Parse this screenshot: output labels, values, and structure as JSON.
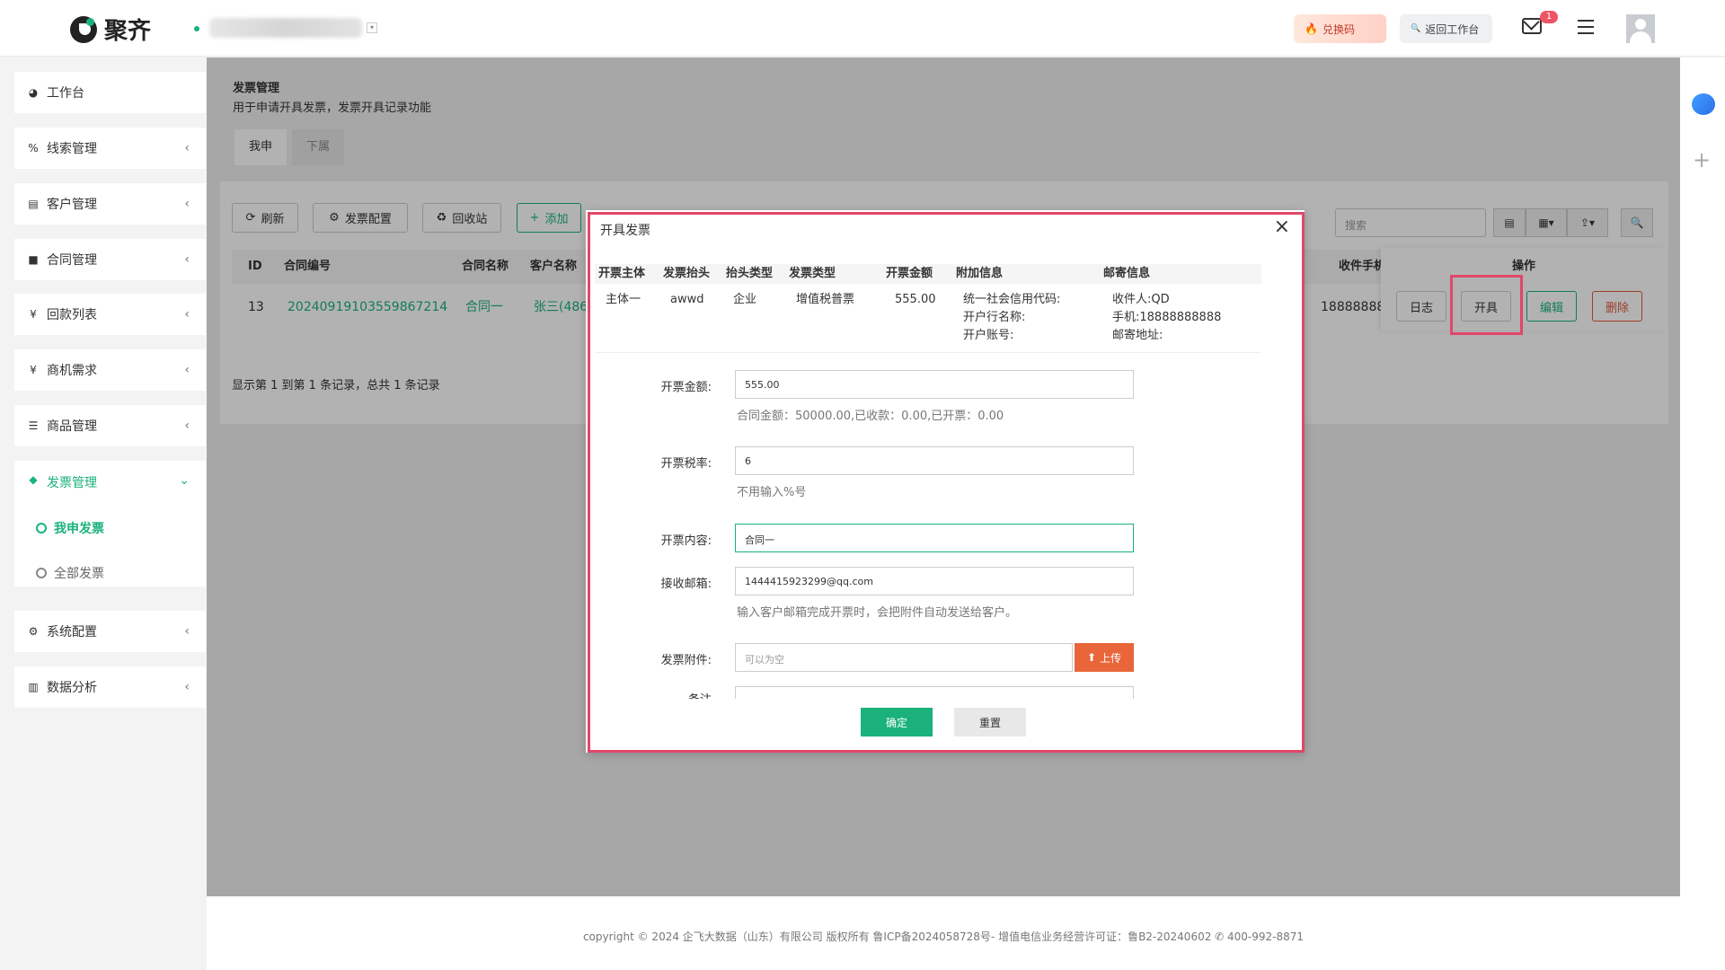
{
  "header": {
    "brand": "聚齐",
    "redeem": "兑换码",
    "return": "返回工作台",
    "mail_badge": "1"
  },
  "sidebar": {
    "items": [
      {
        "label": "工作台",
        "icon": "dashboard-icon"
      },
      {
        "label": "线索管理",
        "icon": "link-icon"
      },
      {
        "label": "客户管理",
        "icon": "id-card-icon"
      },
      {
        "label": "合同管理",
        "icon": "bookmark-icon"
      },
      {
        "label": "回款列表",
        "icon": "yen-icon"
      },
      {
        "label": "商机需求",
        "icon": "yen-icon"
      },
      {
        "label": "商品管理",
        "icon": "list-icon"
      },
      {
        "label": "发票管理",
        "icon": "tag-icon"
      },
      {
        "label": "系统配置",
        "icon": "gears-icon"
      },
      {
        "label": "数据分析",
        "icon": "bar-chart-icon"
      }
    ],
    "sub_items": [
      "我申发票",
      "全部发票"
    ]
  },
  "page": {
    "title": "发票管理",
    "subtitle": "用于申请开具发票，发票开具记录功能",
    "tabs": [
      "我申",
      "下属"
    ]
  },
  "toolbar": {
    "refresh": "刷新",
    "config": "发票配置",
    "recycle": "回收站",
    "add": "添加",
    "search_placeholder": "搜索"
  },
  "table": {
    "headers": [
      "ID",
      "合同编号",
      "合同名称",
      "客户名称",
      "收件手机",
      "操作"
    ],
    "row": {
      "id": "13",
      "contract_no": "20240919103559867214",
      "contract_name": "合同一",
      "customer": "张三(486",
      "phone": "18888888"
    },
    "actions": [
      "日志",
      "开具",
      "编辑",
      "删除"
    ],
    "pager": "显示第 1 到第 1 条记录，总共 1 条记录"
  },
  "modal": {
    "title": "开具发票",
    "columns": [
      "开票主体",
      "发票抬头",
      "抬头类型",
      "发票类型",
      "开票金额",
      "附加信息",
      "邮寄信息"
    ],
    "row": {
      "subject": "主体一",
      "head": "awwd",
      "head_type": "企业",
      "invoice_type": "增值税普票",
      "amount": "555.00",
      "extra": [
        "统一社会信用代码:",
        "开户行名称:",
        "开户账号:"
      ],
      "mail": [
        "收件人:QD",
        "手机:18888888888",
        "邮寄地址:"
      ]
    },
    "form": {
      "amount_label": "开票金额:",
      "amount_value": "555.00",
      "amount_help": "合同金额：50000.00,已收款：0.00,已开票：0.00",
      "rate_label": "开票税率:",
      "rate_value": "6",
      "rate_help": "不用输入%号",
      "content_label": "开票内容:",
      "content_value": "合同一",
      "email_label": "接收邮箱:",
      "email_value": "1444415923299@qq.com",
      "email_help": "输入客户邮箱完成开票时，会把附件自动发送给客户。",
      "attach_label": "发票附件:",
      "attach_placeholder": "可以为空",
      "upload": "上传",
      "remark_label": "备注"
    },
    "ok": "确定",
    "reset": "重置"
  },
  "footer": "copyright © 2024 企飞大数据（山东）有限公司 版权所有    鲁ICP备2024058728号-   增值电信业务经营许可证：鲁B2-20240602 ✆ 400-992-8871"
}
